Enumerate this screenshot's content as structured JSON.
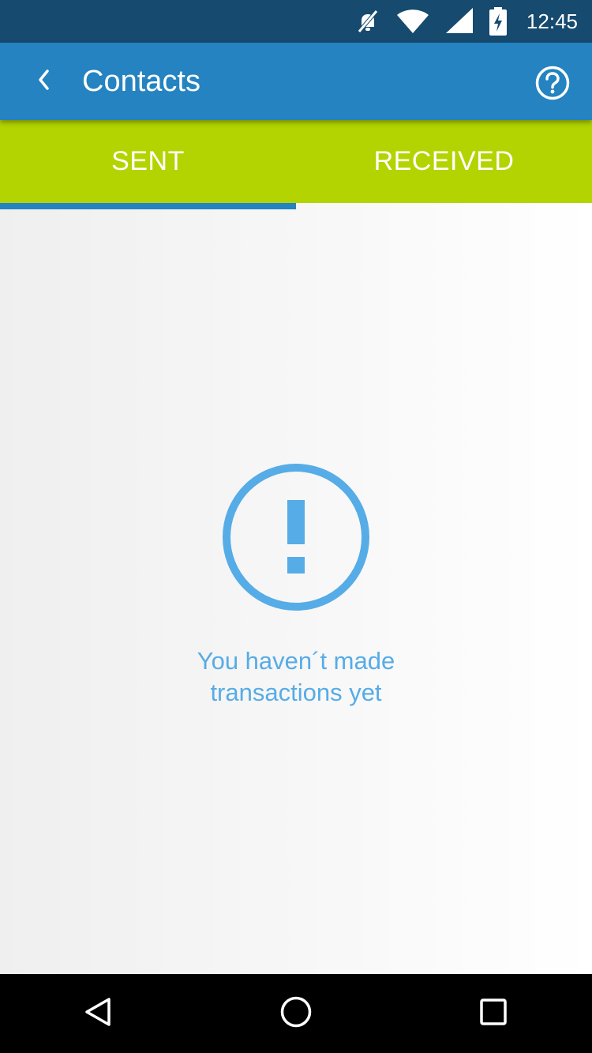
{
  "status_bar": {
    "time": "12:45",
    "icons": [
      "mute-icon",
      "wifi-icon",
      "signal-icon",
      "battery-icon"
    ]
  },
  "app_bar": {
    "title": "Contacts",
    "back_icon": "back-arrow-icon",
    "help_icon": "help-icon"
  },
  "tabs": [
    {
      "label": "SENT",
      "selected": true
    },
    {
      "label": "RECEIVED",
      "selected": false
    }
  ],
  "empty_state": {
    "icon": "alert-circle-icon",
    "message": "You haven´t made transactions yet"
  },
  "nav_bar": {
    "buttons": [
      "back-nav-icon",
      "home-nav-icon",
      "recents-nav-icon"
    ]
  },
  "colors": {
    "status_bar": "#164a6e",
    "app_bar": "#2483c0",
    "tabs_bg": "#b3d400",
    "tab_indicator": "#2483c0",
    "accent_text": "#56ace6"
  }
}
